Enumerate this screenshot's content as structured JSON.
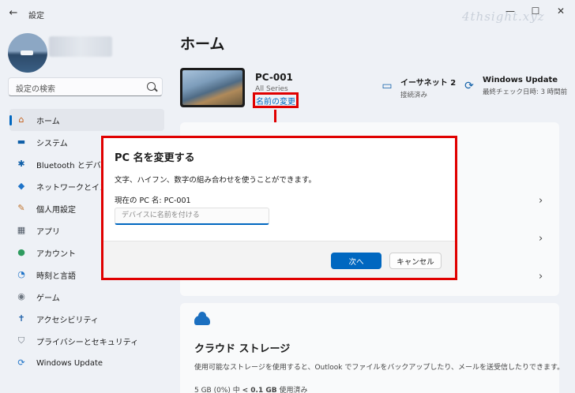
{
  "window": {
    "title": "設定",
    "back_icon": "←",
    "minimize_icon": "—",
    "maximize_icon": "☐",
    "close_icon": "✕",
    "watermark": "4thsight.xyz"
  },
  "sidebar": {
    "search_placeholder": "設定の検索",
    "items": [
      {
        "label": "ホーム",
        "icon": "⌂",
        "color": "#c55a11",
        "active": true
      },
      {
        "label": "システム",
        "icon": "▬",
        "color": "#0f5fa8",
        "active": false
      },
      {
        "label": "Bluetooth とデバイス",
        "icon": "✱",
        "color": "#0f5fa8",
        "active": false
      },
      {
        "label": "ネットワークとインターネット",
        "icon": "◆",
        "color": "#1e73c8",
        "active": false
      },
      {
        "label": "個人用設定",
        "icon": "✎",
        "color": "#c0722b",
        "active": false
      },
      {
        "label": "アプリ",
        "icon": "▦",
        "color": "#505a66",
        "active": false
      },
      {
        "label": "アカウント",
        "icon": "●",
        "color": "#2e9b5f",
        "active": false
      },
      {
        "label": "時刻と言語",
        "icon": "◔",
        "color": "#1e73c8",
        "active": false
      },
      {
        "label": "ゲーム",
        "icon": "◉",
        "color": "#6d7680",
        "active": false
      },
      {
        "label": "アクセシビリティ",
        "icon": "✝",
        "color": "#1a5ea8",
        "active": false
      },
      {
        "label": "プライバシーとセキュリティ",
        "icon": "⛉",
        "color": "#6d7680",
        "active": false
      },
      {
        "label": "Windows Update",
        "icon": "⟳",
        "color": "#1e73c8",
        "active": false
      }
    ]
  },
  "main": {
    "title": "ホーム",
    "device": {
      "name": "PC-001",
      "model": "All Series",
      "rename_link": "名前の変更"
    },
    "status": [
      {
        "title": "イーサネット 2",
        "sub": "接続済み",
        "icon": "▭"
      },
      {
        "title": "Windows Update",
        "sub": "最終チェック日時: 3 時間前",
        "icon": "⟳"
      }
    ],
    "cloud": {
      "title": "クラウド ストレージ",
      "description": "使用可能なストレージを使用すると、Outlook でファイルをバックアップしたり、メールを送受信したりできます。",
      "usage_prefix": "5 GB (0%) 中 ",
      "usage_bold": "< 0.1 GB",
      "usage_suffix": " 使用済み"
    }
  },
  "dialog": {
    "title": "PC 名を変更する",
    "description": "文字、ハイフン、数字の組み合わせを使うことができます。",
    "current_name": "現在の PC 名: PC-001",
    "input_placeholder": "デバイスに名前を付ける",
    "next_button": "次へ",
    "cancel_button": "キャンセル"
  },
  "colors": {
    "accent": "#0067c0",
    "highlight": "#e00000"
  }
}
